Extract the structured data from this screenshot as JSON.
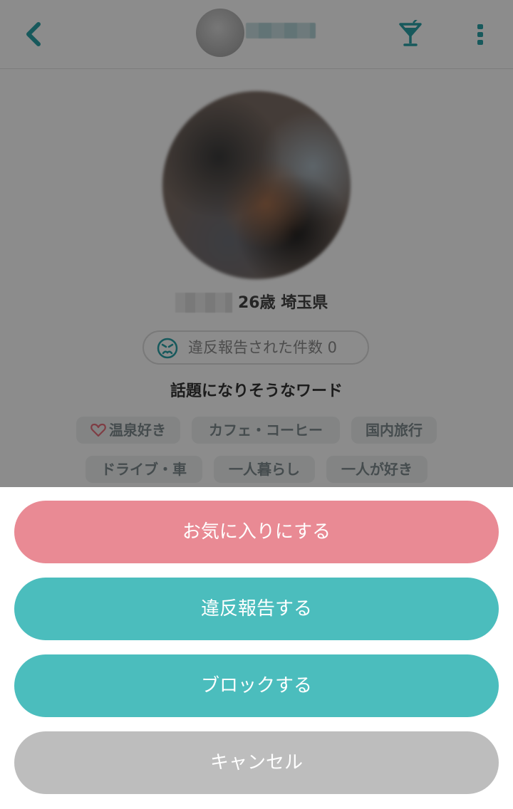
{
  "header": {
    "back_icon": "chevron-left-icon",
    "cocktail_icon": "cocktail-icon",
    "more_icon": "vertical-dots-icon"
  },
  "profile": {
    "age_location": "26歳 埼玉県",
    "violation_label": "違反報告された件数 0",
    "violation_icon": "angry-face-icon"
  },
  "topics": {
    "title": "話題になりそうなワード",
    "tags": [
      "温泉好き",
      "カフェ・コーヒー",
      "国内旅行",
      "ドライブ・車",
      "一人暮らし",
      "一人が好き"
    ]
  },
  "action_sheet": {
    "favorite": "お気に入りにする",
    "report": "違反報告する",
    "block": "ブロックする",
    "cancel": "キャンセル"
  },
  "colors": {
    "accent": "#4bbdbd",
    "favorite": "#e98a94",
    "cancel": "#bdbdbd"
  }
}
